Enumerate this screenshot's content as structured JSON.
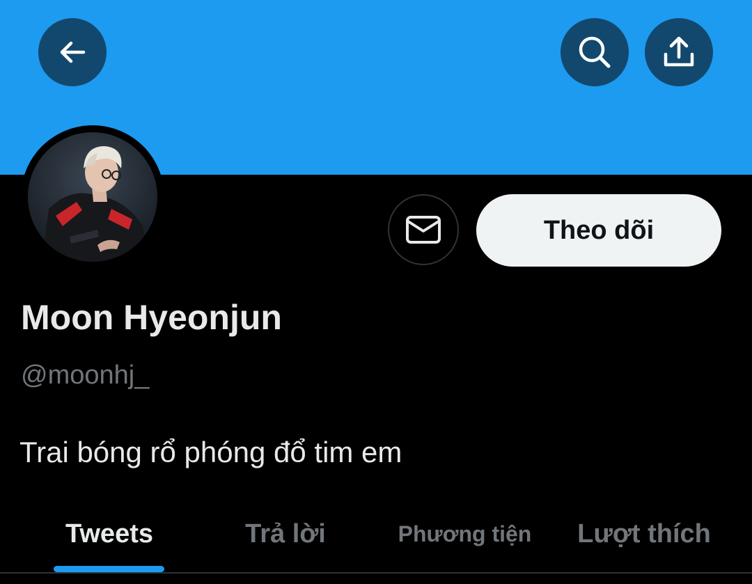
{
  "header": {
    "banner_color": "#1d9bf0",
    "back_icon": "arrow-left-icon",
    "search_icon": "search-icon",
    "share_icon": "share-upload-icon"
  },
  "profile": {
    "avatar_icon": "profile-avatar-photo",
    "display_name": "Moon Hyeonjun",
    "handle": "@moonhj_",
    "bio": "Trai bóng rổ phóng đổ tim em"
  },
  "actions": {
    "message_icon": "envelope-icon",
    "follow_label": "Theo dõi"
  },
  "tabs": [
    {
      "label": "Tweets",
      "active": true
    },
    {
      "label": "Trả lời",
      "active": false
    },
    {
      "label": "Phương tiện",
      "active": false
    },
    {
      "label": "Lượt thích",
      "active": false
    }
  ],
  "colors": {
    "accent": "#1d9bf0",
    "background": "#000000",
    "primary_text": "#e7e9ea",
    "secondary_text": "#71767b",
    "follow_button_bg": "#eff3f4"
  }
}
